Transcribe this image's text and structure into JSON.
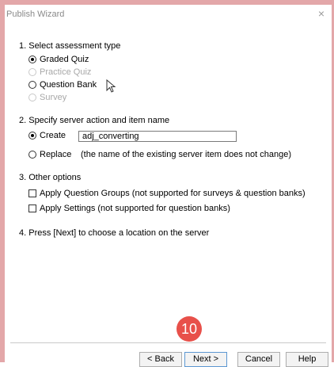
{
  "window": {
    "title": "Publish Wizard",
    "close_glyph": "×"
  },
  "section1": {
    "title": "1.  Select assessment type",
    "options": [
      {
        "label": "Graded Quiz",
        "selected": true,
        "disabled": false
      },
      {
        "label": "Practice Quiz",
        "selected": false,
        "disabled": true
      },
      {
        "label": "Question Bank",
        "selected": false,
        "disabled": false
      },
      {
        "label": "Survey",
        "selected": false,
        "disabled": true
      }
    ]
  },
  "section2": {
    "title": "2.  Specify server action and item name",
    "create_label": "Create",
    "create_value": "adj_converting",
    "replace_label": "Replace",
    "replace_note": "(the name of the existing server item does not change)"
  },
  "section3": {
    "title": "3.  Other options",
    "option1": "Apply Question Groups (not supported for surveys & question banks)",
    "option2": "Apply Settings (not supported for question banks)"
  },
  "section4": {
    "title": "4.  Press [Next] to choose a location on the server"
  },
  "badge": {
    "value": "10"
  },
  "buttons": {
    "back": "< Back",
    "next": "Next >",
    "cancel": "Cancel",
    "help": "Help"
  }
}
